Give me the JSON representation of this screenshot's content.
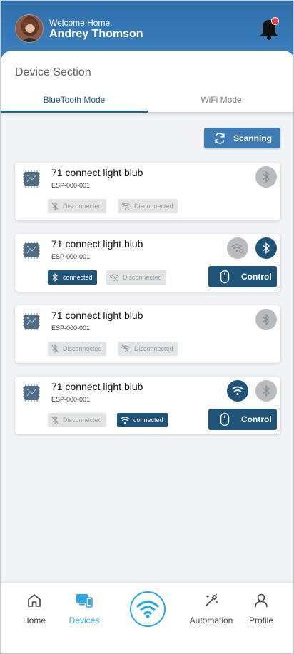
{
  "header": {
    "welcome": "Welcome Home,",
    "username": "Andrey Thomson"
  },
  "section": {
    "title": "Device Section",
    "tabs": [
      {
        "label": "BlueTooth Mode",
        "active": true
      },
      {
        "label": "WiFi Mode",
        "active": false
      }
    ]
  },
  "scan_button": {
    "label": "Scanning"
  },
  "devices": [
    {
      "name": "71 connect light blub",
      "id": "ESP-000-001",
      "bluetooth_status": "Disconnected",
      "wifi_status": "Disconnected",
      "bluetooth_connected": false,
      "wifi_connected": false,
      "control": null
    },
    {
      "name": "71 connect light blub",
      "id": "ESP-000-001",
      "bluetooth_status": "connected",
      "wifi_status": "Disconnected",
      "bluetooth_connected": true,
      "wifi_connected": false,
      "control": "Control"
    },
    {
      "name": "71 connect light blub",
      "id": "ESP-000-001",
      "bluetooth_status": "Disconnected",
      "wifi_status": "Disconnected",
      "bluetooth_connected": false,
      "wifi_connected": false,
      "control": null
    },
    {
      "name": "71 connect light blub",
      "id": "ESP-000-001",
      "bluetooth_status": "Disconnected",
      "wifi_status": "connected",
      "bluetooth_connected": false,
      "wifi_connected": true,
      "control": "Control"
    }
  ],
  "bottom_nav": {
    "home": "Home",
    "devices": "Devices",
    "automation": "Automation",
    "profile": "Profile"
  },
  "colors": {
    "header": "#3d82c0",
    "primary_dark": "#1f5377",
    "accent": "#2aa6e0",
    "notification_dot": "#e53935"
  }
}
